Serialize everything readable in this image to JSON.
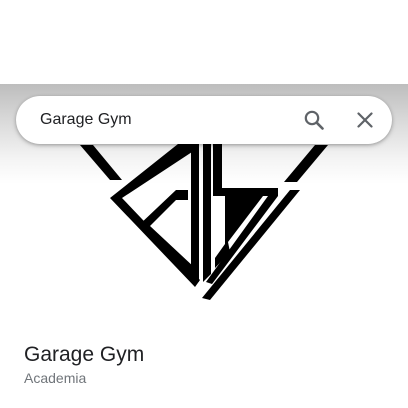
{
  "search": {
    "query": "Garage Gym"
  },
  "icons": {
    "search": "search-icon",
    "close": "close-icon",
    "logo": "garage-gym-logo"
  },
  "place": {
    "title": "Garage Gym",
    "category": "Academia"
  },
  "colors": {
    "text_primary": "#202124",
    "text_secondary": "#70757a",
    "icon": "#5f6368",
    "logo": "#000000"
  }
}
